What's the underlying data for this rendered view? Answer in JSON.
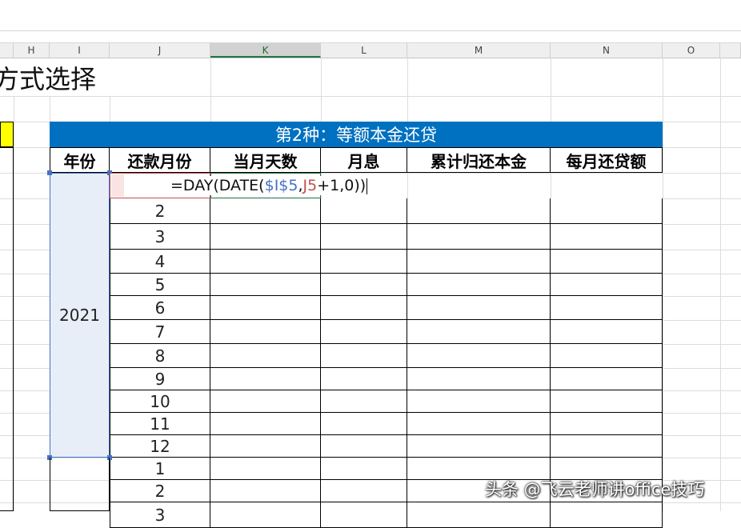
{
  "columns": [
    "H",
    "I",
    "J",
    "K",
    "L",
    "M",
    "N",
    "O"
  ],
  "section_title": "方式选择",
  "banner": "第2种：等额本金还贷",
  "headers": [
    "年份",
    "还款月份",
    "当月天数",
    "月息",
    "累计归还本金",
    "每月还贷额"
  ],
  "year": "2021",
  "formula": {
    "prefix": "=DAY(DATE(",
    "ref1": "$I$5",
    "comma1": ",",
    "ref2": "J5",
    "suffix": "+1,0)",
    "close": ")"
  },
  "months": [
    "2",
    "3",
    "4",
    "5",
    "6",
    "7",
    "8",
    "9",
    "10",
    "11",
    "12",
    "1",
    "2",
    "3"
  ],
  "watermark": "头条 @飞云老师讲office技巧",
  "colors": {
    "banner": "#0070c0",
    "yellow": "#ffff00",
    "year_fill": "#e8eef8",
    "ref1": "#4472c4",
    "ref2": "#c0504d"
  }
}
